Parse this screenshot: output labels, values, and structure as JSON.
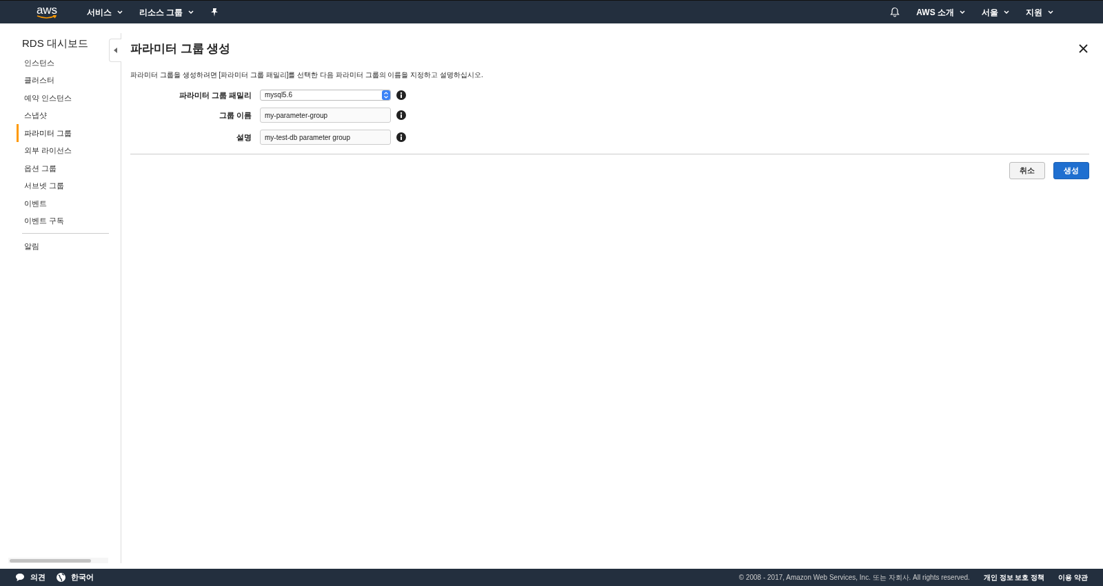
{
  "header": {
    "logo": "aws",
    "nav": [
      {
        "label": "서비스",
        "kind": "menu"
      },
      {
        "label": "리소스 그룹",
        "kind": "menu"
      },
      {
        "kind": "pin"
      }
    ],
    "right": [
      {
        "kind": "bell"
      },
      {
        "label": "AWS 소개",
        "kind": "menu"
      },
      {
        "label": "서울",
        "kind": "menu"
      },
      {
        "label": "지원",
        "kind": "menu"
      }
    ]
  },
  "sidebar": {
    "title": "RDS 대시보드",
    "items": [
      {
        "label": "인스턴스",
        "selected": false
      },
      {
        "label": "클러스터",
        "selected": false
      },
      {
        "label": "예약 인스턴스",
        "selected": false
      },
      {
        "label": "스냅샷",
        "selected": false
      },
      {
        "label": "파라미터 그룹",
        "selected": true
      },
      {
        "label": "외부 라이선스",
        "selected": false
      },
      {
        "label": "옵션 그룹",
        "selected": false
      },
      {
        "label": "서브넷 그룹",
        "selected": false
      },
      {
        "label": "이벤트",
        "selected": false
      },
      {
        "label": "이벤트 구독",
        "selected": false
      }
    ],
    "extra_items": [
      {
        "label": "알림",
        "selected": false
      }
    ]
  },
  "dialog": {
    "title": "파라미터 그룹 생성",
    "description": "파라미터 그룹을 생성하려면 [파라미터 그룹 패밀리]를 선택한 다음 파라미터 그룹의 이름을 지정하고 설명하십시오.",
    "fields": [
      {
        "label": "파라미터 그룹 패밀리",
        "kind": "select",
        "value": "mysql5.6"
      },
      {
        "label": "그룹 이름",
        "kind": "text",
        "value": "my-parameter-group"
      },
      {
        "label": "설명",
        "kind": "text",
        "value": "my-test-db parameter group"
      }
    ],
    "buttons": [
      {
        "label": "취소",
        "kind": "secondary"
      },
      {
        "label": "생성",
        "kind": "primary"
      }
    ]
  },
  "footer": {
    "left": [
      {
        "label": "의견",
        "kind": "feedback"
      },
      {
        "label": "한국어",
        "kind": "language"
      }
    ],
    "copyright": "© 2008 - 2017, Amazon Web Services, Inc. 또는 자회사. All rights reserved.",
    "links": [
      "개인 정보 보호 정책",
      "이용 약관"
    ]
  }
}
